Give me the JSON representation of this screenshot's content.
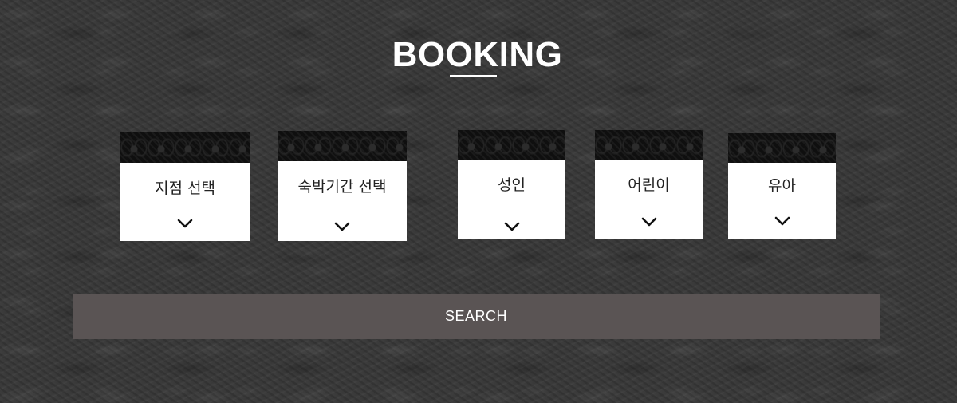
{
  "booking": {
    "title": "BOOKING",
    "fields": [
      {
        "label": "지점 선택"
      },
      {
        "label": "숙박기간 선택"
      },
      {
        "label": "성인"
      },
      {
        "label": "어린이"
      },
      {
        "label": "유아"
      }
    ],
    "search_label": "SEARCH"
  },
  "colors": {
    "background": "#3a3a3a",
    "panel": "#ffffff",
    "search_button": "#5a5454",
    "title": "#ffffff"
  },
  "icons": {
    "dropdown": "chevron-down-icon"
  }
}
